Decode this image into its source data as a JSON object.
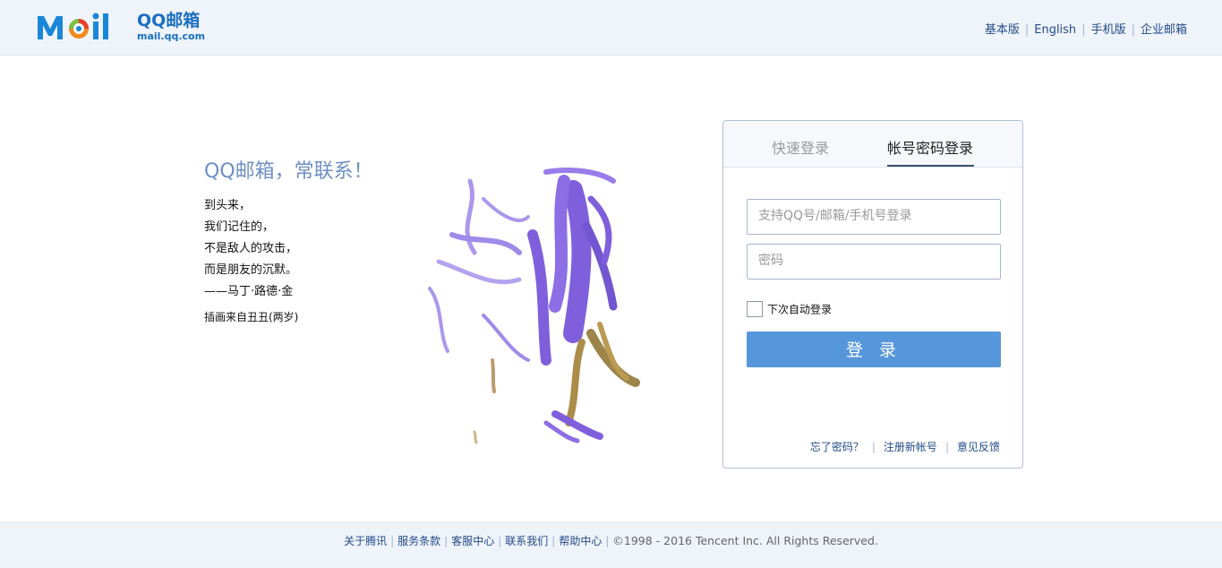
{
  "header": {
    "logo_qq": "QQ邮箱",
    "logo_url": "mail.qq.com",
    "nav": [
      "基本版",
      "English",
      "手机版",
      "企业邮箱"
    ]
  },
  "intro": {
    "slogan": "QQ邮箱，常联系！",
    "poem": [
      "到头来，",
      "我们记住的，",
      "不是敌人的攻击，",
      "而是朋友的沉默。",
      "——马丁·路德·金"
    ],
    "credit": "插画来自丑丑(两岁)"
  },
  "login": {
    "tabs": [
      "快速登录",
      "帐号密码登录"
    ],
    "active_tab": "帐号密码登录",
    "username_placeholder": "支持QQ号/邮箱/手机号登录",
    "password_placeholder": "密码",
    "remember_label": "下次自动登录",
    "remember_checked": false,
    "submit_label": "登 录",
    "links": [
      "忘了密码？",
      "注册新帐号",
      "意见反馈"
    ]
  },
  "footer": {
    "links": [
      "关于腾讯",
      "服务条款",
      "客服中心",
      "联系我们",
      "帮助中心"
    ],
    "copyright": "©1998 - 2016 Tencent Inc. All Rights Reserved."
  },
  "colors": {
    "brand": "#1a6fc1",
    "button": "#5697db",
    "header_bg": "#eff3fa",
    "slogan": "#6e8fc4"
  }
}
